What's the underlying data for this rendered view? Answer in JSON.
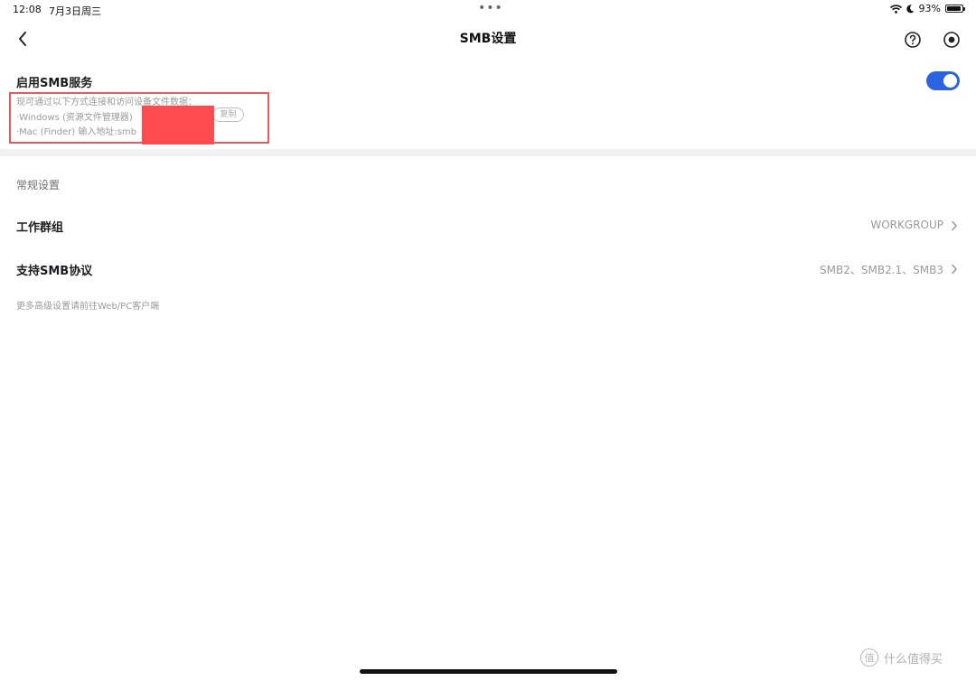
{
  "status_bar": {
    "time": "12:08",
    "date": "7月3日周三",
    "battery": "93%",
    "battery_level": 0.93
  },
  "nav": {
    "title": "SMB设置"
  },
  "smb": {
    "enable_label": "启用SMB服务",
    "enabled": true,
    "desc_intro": "现可通过以下方式连接和访问设备文件数据：",
    "desc_windows": "·Windows (资源文件管理器)",
    "desc_mac": "·Mac (Finder) 输入地址:smb",
    "copy_label": "复制"
  },
  "general": {
    "header": "常规设置",
    "workgroup_label": "工作群组",
    "workgroup_value": "WORKGROUP",
    "protocol_label": "支持SMB协议",
    "protocol_value": "SMB2、SMB2.1、SMB3"
  },
  "footer_note": "更多高级设置请前往Web/PC客户端",
  "watermark": {
    "badge": "值",
    "text": "什么值得买"
  },
  "colors": {
    "accent": "#2b63e0",
    "highlight_border": "#e85a5f",
    "redaction": "#ff4a4f"
  }
}
